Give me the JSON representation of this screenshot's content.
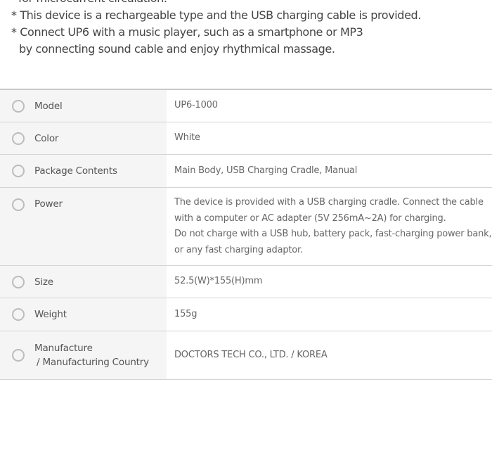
{
  "intro": {
    "lines": [
      "for microcurrent circulation.",
      "* This device is a rechargeable type and the USB charging cable is provided.",
      "* Connect UP6 with a music player, such as a smartphone or MP3",
      "by connecting sound cable and enjoy rhythmical massage."
    ]
  },
  "specs": {
    "model": {
      "label": "Model",
      "value": "UP6-1000"
    },
    "color": {
      "label": "Color",
      "value": "White"
    },
    "package": {
      "label": "Package Contents",
      "value": "Main Body, USB Charging Cradle, Manual"
    },
    "power": {
      "label": "Power",
      "lines": [
        "The device is provided with a USB charging cradle. Connect the cable",
        "with a computer or AC adapter (5V 256mA~2A) for charging.",
        "Do not charge with a USB hub, battery pack, fast-charging power bank,",
        "or any fast charging adaptor."
      ]
    },
    "size": {
      "label": "Size",
      "value": "52.5(W)*155(H)mm"
    },
    "weight": {
      "label": "Weight",
      "value": "155g"
    },
    "manufacturer": {
      "label_line1": "Manufacture",
      "label_line2": "/ Manufacturing Country",
      "value": "DOCTORS TECH CO., LTD. / KOREA"
    }
  }
}
